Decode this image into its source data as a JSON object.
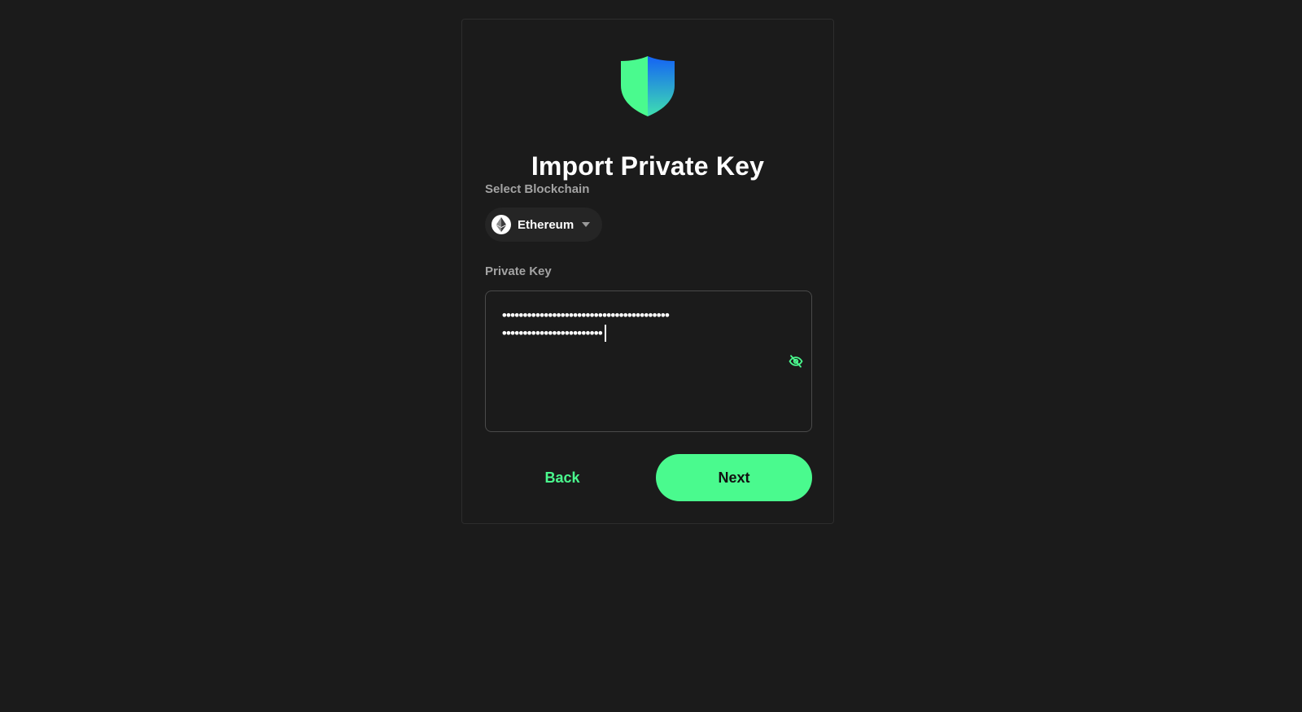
{
  "page": {
    "title": "Import Private Key"
  },
  "blockchain": {
    "label": "Select Blockchain",
    "selected": "Ethereum",
    "icon": "ethereum-icon"
  },
  "private_key": {
    "label": "Private Key",
    "masked_line_1": "••••••••••••••••••••••••••••••••••••••••",
    "masked_line_2": "••••••••••••••••••••••••",
    "visibility_icon": "eye-off-icon"
  },
  "actions": {
    "back_label": "Back",
    "next_label": "Next"
  },
  "colors": {
    "background": "#1b1b1b",
    "accent": "#4afa8e",
    "logo_gradient_start": "#4afa8e",
    "logo_gradient_end": "#1462f5"
  }
}
